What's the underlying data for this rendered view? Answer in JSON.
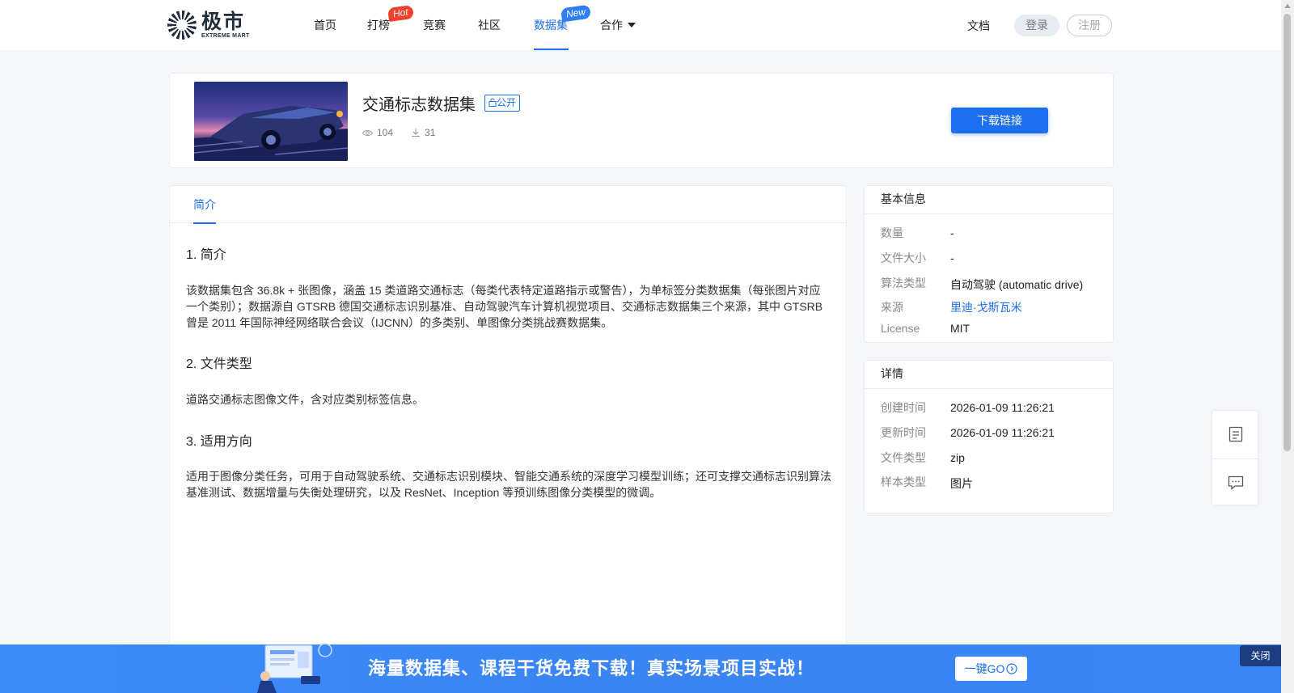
{
  "brand": {
    "name_cn": "极市",
    "name_en": "EXTREME MART"
  },
  "nav": {
    "items": [
      {
        "label": "首页"
      },
      {
        "label": "打榜",
        "badge": "Hot"
      },
      {
        "label": "竞赛"
      },
      {
        "label": "社区"
      },
      {
        "label": "数据集",
        "badge": "New",
        "active": true
      },
      {
        "label": "合作"
      }
    ],
    "docs": "文档",
    "login": "登录",
    "register": "注册"
  },
  "dataset": {
    "title": "交通标志数据集",
    "visibility": "公开",
    "views": "104",
    "downloads": "31",
    "download_button": "下载链接"
  },
  "tabs": [
    {
      "label": "简介",
      "active": true
    }
  ],
  "intro": {
    "s1_title": "1. 简介",
    "s1_body": "该数据集包含 36.8k + 张图像，涵盖 15 类道路交通标志（每类代表特定道路指示或警告），为单标签分类数据集（每张图片对应一个类别）；数据源自 GTSRB 德国交通标志识别基准、自动驾驶汽车计算机视觉项目、交通标志数据集三个来源，其中 GTSRB 曾是 2011 年国际神经网络联合会议（IJCNN）的多类别、单图像分类挑战赛数据集。",
    "s2_title": "2. 文件类型",
    "s2_body": "道路交通标志图像文件，含对应类别标签信息。",
    "s3_title": "3. 适用方向",
    "s3_body": "适用于图像分类任务，可用于自动驾驶系统、交通标志识别模块、智能交通系统的深度学习模型训练；还可支撑交通标志识别算法基准测试、数据增量与失衡处理研究，以及 ResNet、Inception 等预训练图像分类模型的微调。"
  },
  "basic_info": {
    "title": "基本信息",
    "rows": [
      {
        "key": "数量",
        "value": "-"
      },
      {
        "key": "文件大小",
        "value": "-"
      },
      {
        "key": "算法类型",
        "value": "自动驾驶 (automatic drive)"
      },
      {
        "key": "来源",
        "value": "里迪·戈斯瓦米"
      },
      {
        "key": "License",
        "value": "MIT"
      }
    ]
  },
  "details": {
    "title": "详情",
    "rows": [
      {
        "key": "创建时间",
        "value": "2026-01-09 11:26:21"
      },
      {
        "key": "更新时间",
        "value": "2026-01-09 11:26:21"
      },
      {
        "key": "文件类型",
        "value": "zip"
      },
      {
        "key": "样本类型",
        "value": "图片"
      }
    ]
  },
  "banner": {
    "text": "海量数据集、课程干货免费下载！真实场景项目实战！",
    "go_button": "一键GO",
    "close": "关闭"
  },
  "colors": {
    "accent": "#1d6ff2",
    "hot_badge": "#f1402b",
    "new_badge": "#2d7ef7",
    "banner": "#3a86f6"
  }
}
